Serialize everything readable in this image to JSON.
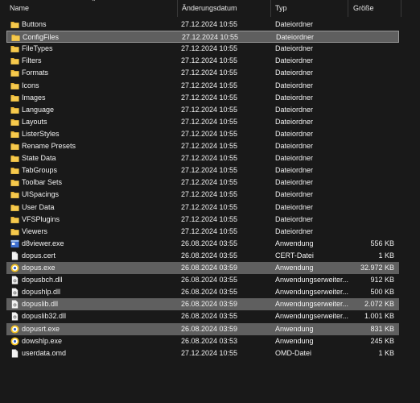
{
  "columns": {
    "name": "Name",
    "date": "Änderungsdatum",
    "type": "Typ",
    "size": "Größe"
  },
  "rows": [
    {
      "name": "Buttons",
      "date": "27.12.2024 10:55",
      "type": "Dateiordner",
      "size": "",
      "icon": "folder-icon",
      "selected": false
    },
    {
      "name": "ConfigFiles",
      "date": "27.12.2024 10:55",
      "type": "Dateiordner",
      "size": "",
      "icon": "folder-icon",
      "selected": true,
      "focused": true
    },
    {
      "name": "FileTypes",
      "date": "27.12.2024 10:55",
      "type": "Dateiordner",
      "size": "",
      "icon": "folder-icon",
      "selected": false
    },
    {
      "name": "Filters",
      "date": "27.12.2024 10:55",
      "type": "Dateiordner",
      "size": "",
      "icon": "folder-icon",
      "selected": false
    },
    {
      "name": "Formats",
      "date": "27.12.2024 10:55",
      "type": "Dateiordner",
      "size": "",
      "icon": "folder-icon",
      "selected": false
    },
    {
      "name": "Icons",
      "date": "27.12.2024 10:55",
      "type": "Dateiordner",
      "size": "",
      "icon": "folder-icon",
      "selected": false
    },
    {
      "name": "Images",
      "date": "27.12.2024 10:55",
      "type": "Dateiordner",
      "size": "",
      "icon": "folder-icon",
      "selected": false
    },
    {
      "name": "Language",
      "date": "27.12.2024 10:55",
      "type": "Dateiordner",
      "size": "",
      "icon": "folder-icon",
      "selected": false
    },
    {
      "name": "Layouts",
      "date": "27.12.2024 10:55",
      "type": "Dateiordner",
      "size": "",
      "icon": "folder-icon",
      "selected": false
    },
    {
      "name": "ListerStyles",
      "date": "27.12.2024 10:55",
      "type": "Dateiordner",
      "size": "",
      "icon": "folder-icon",
      "selected": false
    },
    {
      "name": "Rename Presets",
      "date": "27.12.2024 10:55",
      "type": "Dateiordner",
      "size": "",
      "icon": "folder-icon",
      "selected": false
    },
    {
      "name": "State Data",
      "date": "27.12.2024 10:55",
      "type": "Dateiordner",
      "size": "",
      "icon": "folder-icon",
      "selected": false
    },
    {
      "name": "TabGroups",
      "date": "27.12.2024 10:55",
      "type": "Dateiordner",
      "size": "",
      "icon": "folder-icon",
      "selected": false
    },
    {
      "name": "Toolbar Sets",
      "date": "27.12.2024 10:55",
      "type": "Dateiordner",
      "size": "",
      "icon": "folder-icon",
      "selected": false
    },
    {
      "name": "UISpacings",
      "date": "27.12.2024 10:55",
      "type": "Dateiordner",
      "size": "",
      "icon": "folder-icon",
      "selected": false
    },
    {
      "name": "User Data",
      "date": "27.12.2024 10:55",
      "type": "Dateiordner",
      "size": "",
      "icon": "folder-icon",
      "selected": false
    },
    {
      "name": "VFSPlugins",
      "date": "27.12.2024 10:55",
      "type": "Dateiordner",
      "size": "",
      "icon": "folder-icon",
      "selected": false
    },
    {
      "name": "Viewers",
      "date": "27.12.2024 10:55",
      "type": "Dateiordner",
      "size": "",
      "icon": "folder-icon",
      "selected": false
    },
    {
      "name": "d8viewer.exe",
      "date": "26.08.2024 03:55",
      "type": "Anwendung",
      "size": "556 KB",
      "icon": "application-icon",
      "selected": false
    },
    {
      "name": "dopus.cert",
      "date": "26.08.2024 03:55",
      "type": "CERT-Datei",
      "size": "1 KB",
      "icon": "file-icon",
      "selected": false
    },
    {
      "name": "dopus.exe",
      "date": "26.08.2024 03:59",
      "type": "Anwendung",
      "size": "32.972 KB",
      "icon": "dopus-app-icon",
      "selected": true
    },
    {
      "name": "dopusbch.dll",
      "date": "26.08.2024 03:55",
      "type": "Anwendungserweiter...",
      "size": "912 KB",
      "icon": "dll-icon",
      "selected": false
    },
    {
      "name": "dopushlp.dll",
      "date": "26.08.2024 03:55",
      "type": "Anwendungserweiter...",
      "size": "500 KB",
      "icon": "dll-icon",
      "selected": false
    },
    {
      "name": "dopuslib.dll",
      "date": "26.08.2024 03:59",
      "type": "Anwendungserweiter...",
      "size": "2.072 KB",
      "icon": "dll-icon",
      "selected": true
    },
    {
      "name": "dopuslib32.dll",
      "date": "26.08.2024 03:55",
      "type": "Anwendungserweiter...",
      "size": "1.001 KB",
      "icon": "dll-icon",
      "selected": false
    },
    {
      "name": "dopusrt.exe",
      "date": "26.08.2024 03:59",
      "type": "Anwendung",
      "size": "831 KB",
      "icon": "dopus-app-icon",
      "selected": true
    },
    {
      "name": "dowshlp.exe",
      "date": "26.08.2024 03:53",
      "type": "Anwendung",
      "size": "245 KB",
      "icon": "dopus-app-icon",
      "selected": false
    },
    {
      "name": "userdata.omd",
      "date": "27.12.2024 10:55",
      "type": "OMD-Datei",
      "size": "1 KB",
      "icon": "file-icon",
      "selected": false
    }
  ]
}
